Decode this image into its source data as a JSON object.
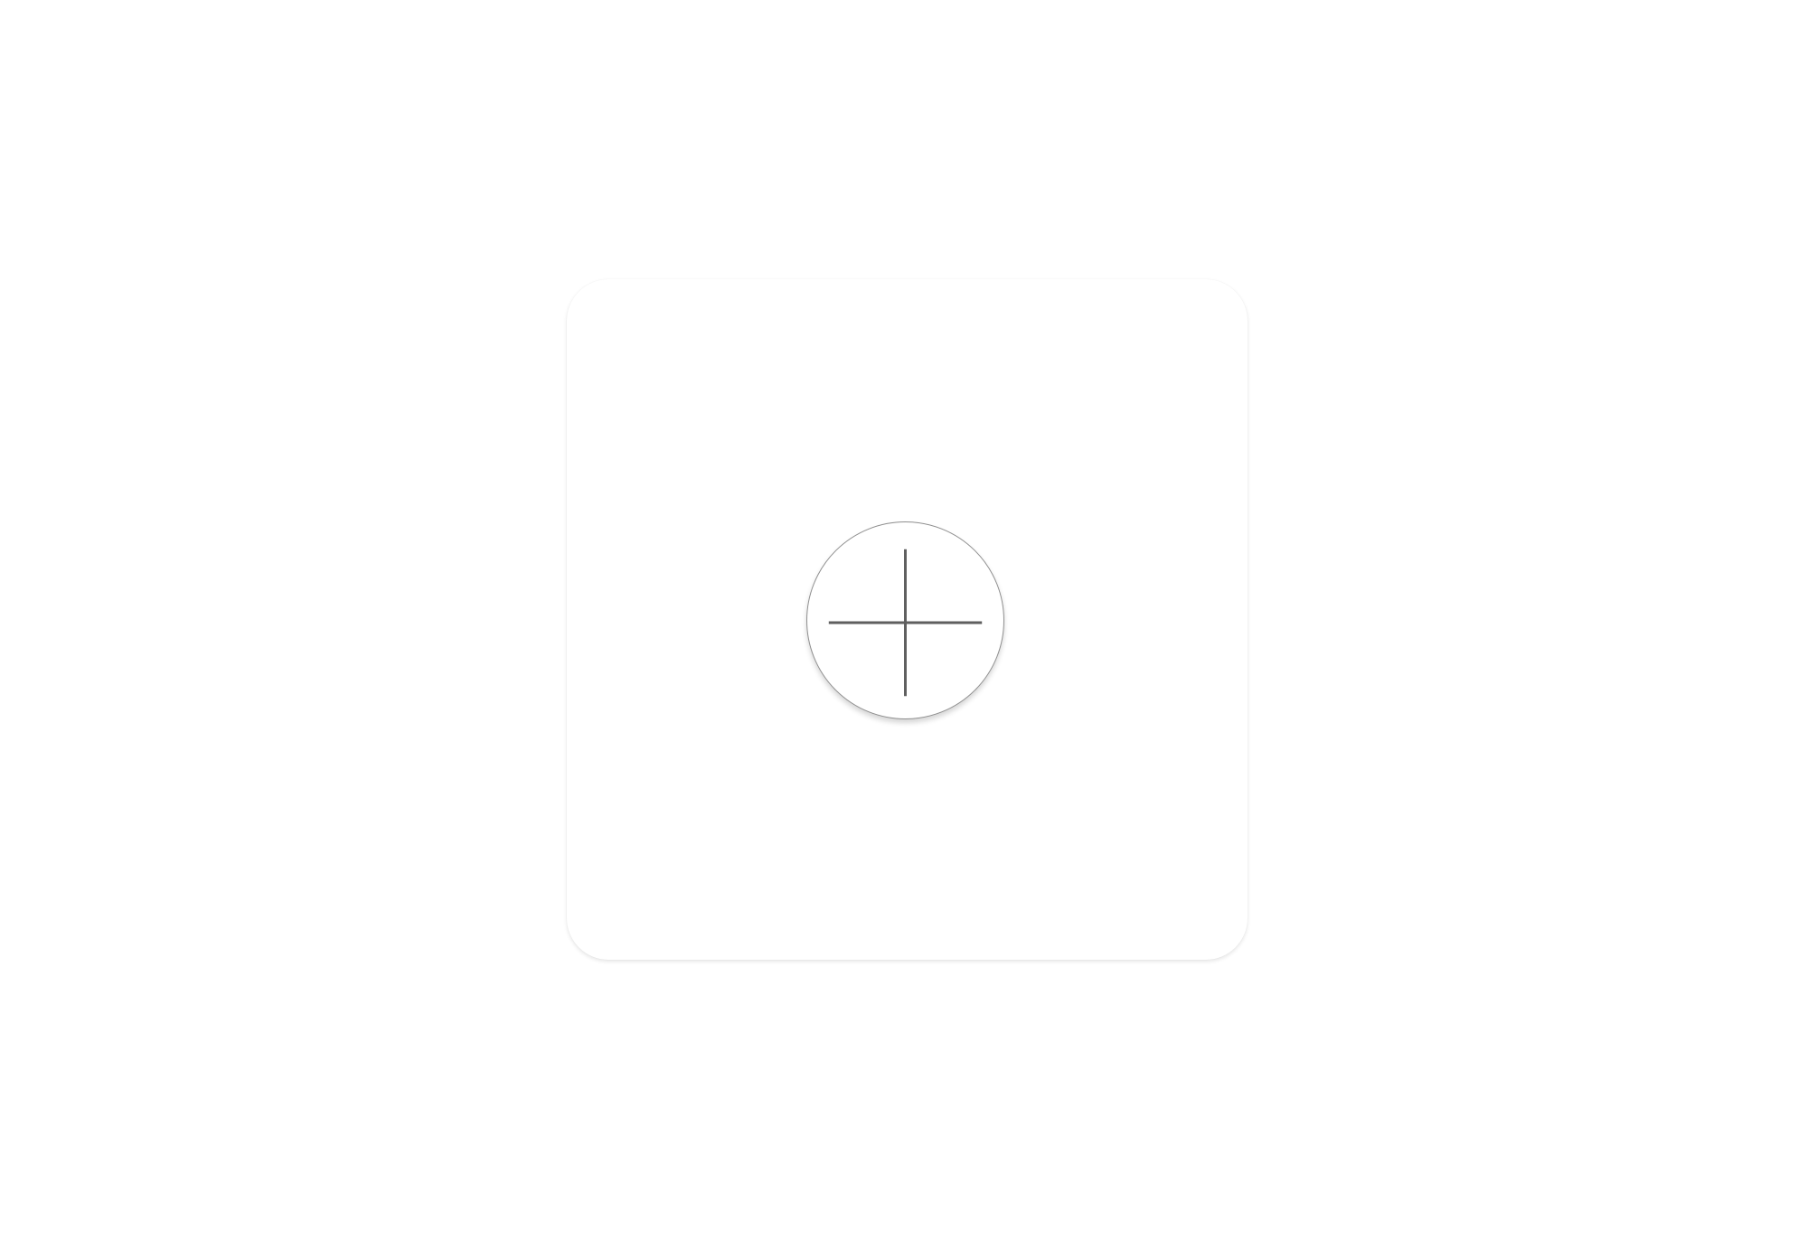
{
  "card": {
    "background": "#ffffff"
  },
  "add_button": {
    "icon": "plus-icon",
    "stroke_color": "#5f5f5f",
    "border_color": "#8e8e8e"
  }
}
